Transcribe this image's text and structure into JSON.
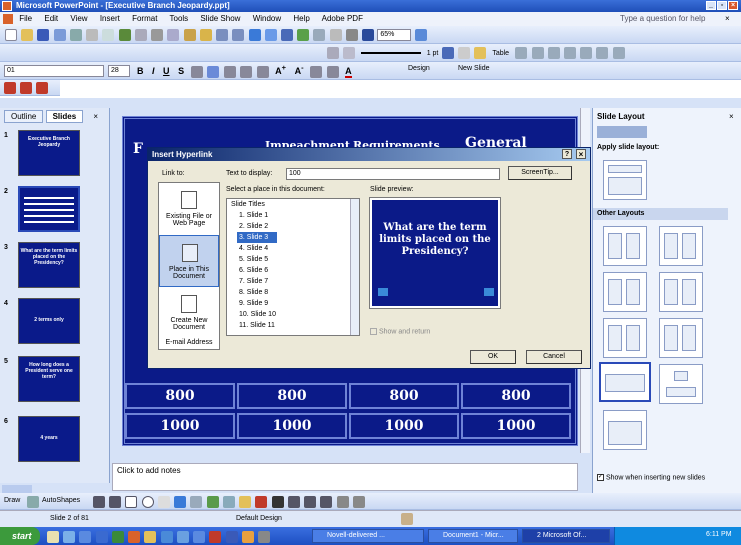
{
  "window": {
    "title": "Microsoft PowerPoint - [Executive Branch Jeopardy.ppt]",
    "help_placeholder": "Type a question for help"
  },
  "menu": [
    "File",
    "Edit",
    "View",
    "Insert",
    "Format",
    "Tools",
    "Slide Show",
    "Window",
    "Help",
    "Adobe PDF"
  ],
  "toolbar": {
    "zoom": "65%",
    "font_name": "01",
    "font_size": "28",
    "line_width": "1 pt",
    "design_label": "Design",
    "new_slide_label": "New Slide",
    "table_label": "Table"
  },
  "sidebar": {
    "tabs": [
      "Outline",
      "Slides"
    ],
    "slides": [
      {
        "num": "1",
        "text": "Executive Branch Jeopardy"
      },
      {
        "num": "2",
        "text": ""
      },
      {
        "num": "3",
        "text": "What are the term limits placed on the Presidency?"
      },
      {
        "num": "4",
        "text": "2 terms only"
      },
      {
        "num": "5",
        "text": "How long does a President serve one term?"
      },
      {
        "num": "6",
        "text": "4 years"
      }
    ]
  },
  "slide": {
    "headers": [
      "F",
      "Impeachment",
      "Requirements",
      "General"
    ],
    "rows": [
      [
        "800",
        "800",
        "800",
        "800"
      ],
      [
        "1000",
        "1000",
        "1000",
        "1000"
      ]
    ]
  },
  "notes_placeholder": "Click to add notes",
  "dialog": {
    "title": "Insert Hyperlink",
    "help": "?",
    "link_to_label": "Link to:",
    "text_to_display_label": "Text to display:",
    "text_to_display_value": "100",
    "screentip_label": "ScreenTip...",
    "place_label": "Select a place in this document:",
    "preview_label": "Slide preview:",
    "link_options": [
      {
        "label": "Existing File or Web Page",
        "icon": "web-page-icon"
      },
      {
        "label": "Place in This Document",
        "icon": "document-place-icon"
      },
      {
        "label": "Create New Document",
        "icon": "new-document-icon"
      },
      {
        "label": "E-mail Address",
        "icon": "email-icon"
      }
    ],
    "tree_root": "Slide Titles",
    "tree_items": [
      "1. Slide 1",
      "2. Slide 2",
      "3. Slide 3",
      "4. Slide 4",
      "5. Slide 5",
      "6. Slide 6",
      "7. Slide 7",
      "8. Slide 8",
      "9. Slide 9",
      "10. Slide 10",
      "11. Slide 11"
    ],
    "selected_index": 2,
    "preview_text": "What are the term limits placed on the Presidency?",
    "show_return_label": "Show and return",
    "ok_label": "OK",
    "cancel_label": "Cancel"
  },
  "task_pane": {
    "title": "Slide Layout",
    "apply_label": "Apply slide layout:",
    "other_label": "Other Layouts",
    "show_when_label": "Show when inserting new slides"
  },
  "drawing_toolbar": {
    "draw_label": "Draw",
    "autoshapes_label": "AutoShapes"
  },
  "status": {
    "slide_info": "Slide 2 of 81",
    "design": "Default Design"
  },
  "taskbar": {
    "start_label": "start",
    "clock": "6:11 PM",
    "buttons": [
      "Novell-delivered ...",
      "Document1 - Micr...",
      "2 Microsoft Of..."
    ]
  },
  "colors": {
    "slide_bg": "#0b1a88",
    "accent": "#1f4fb8",
    "taskbar": "#245edb"
  }
}
